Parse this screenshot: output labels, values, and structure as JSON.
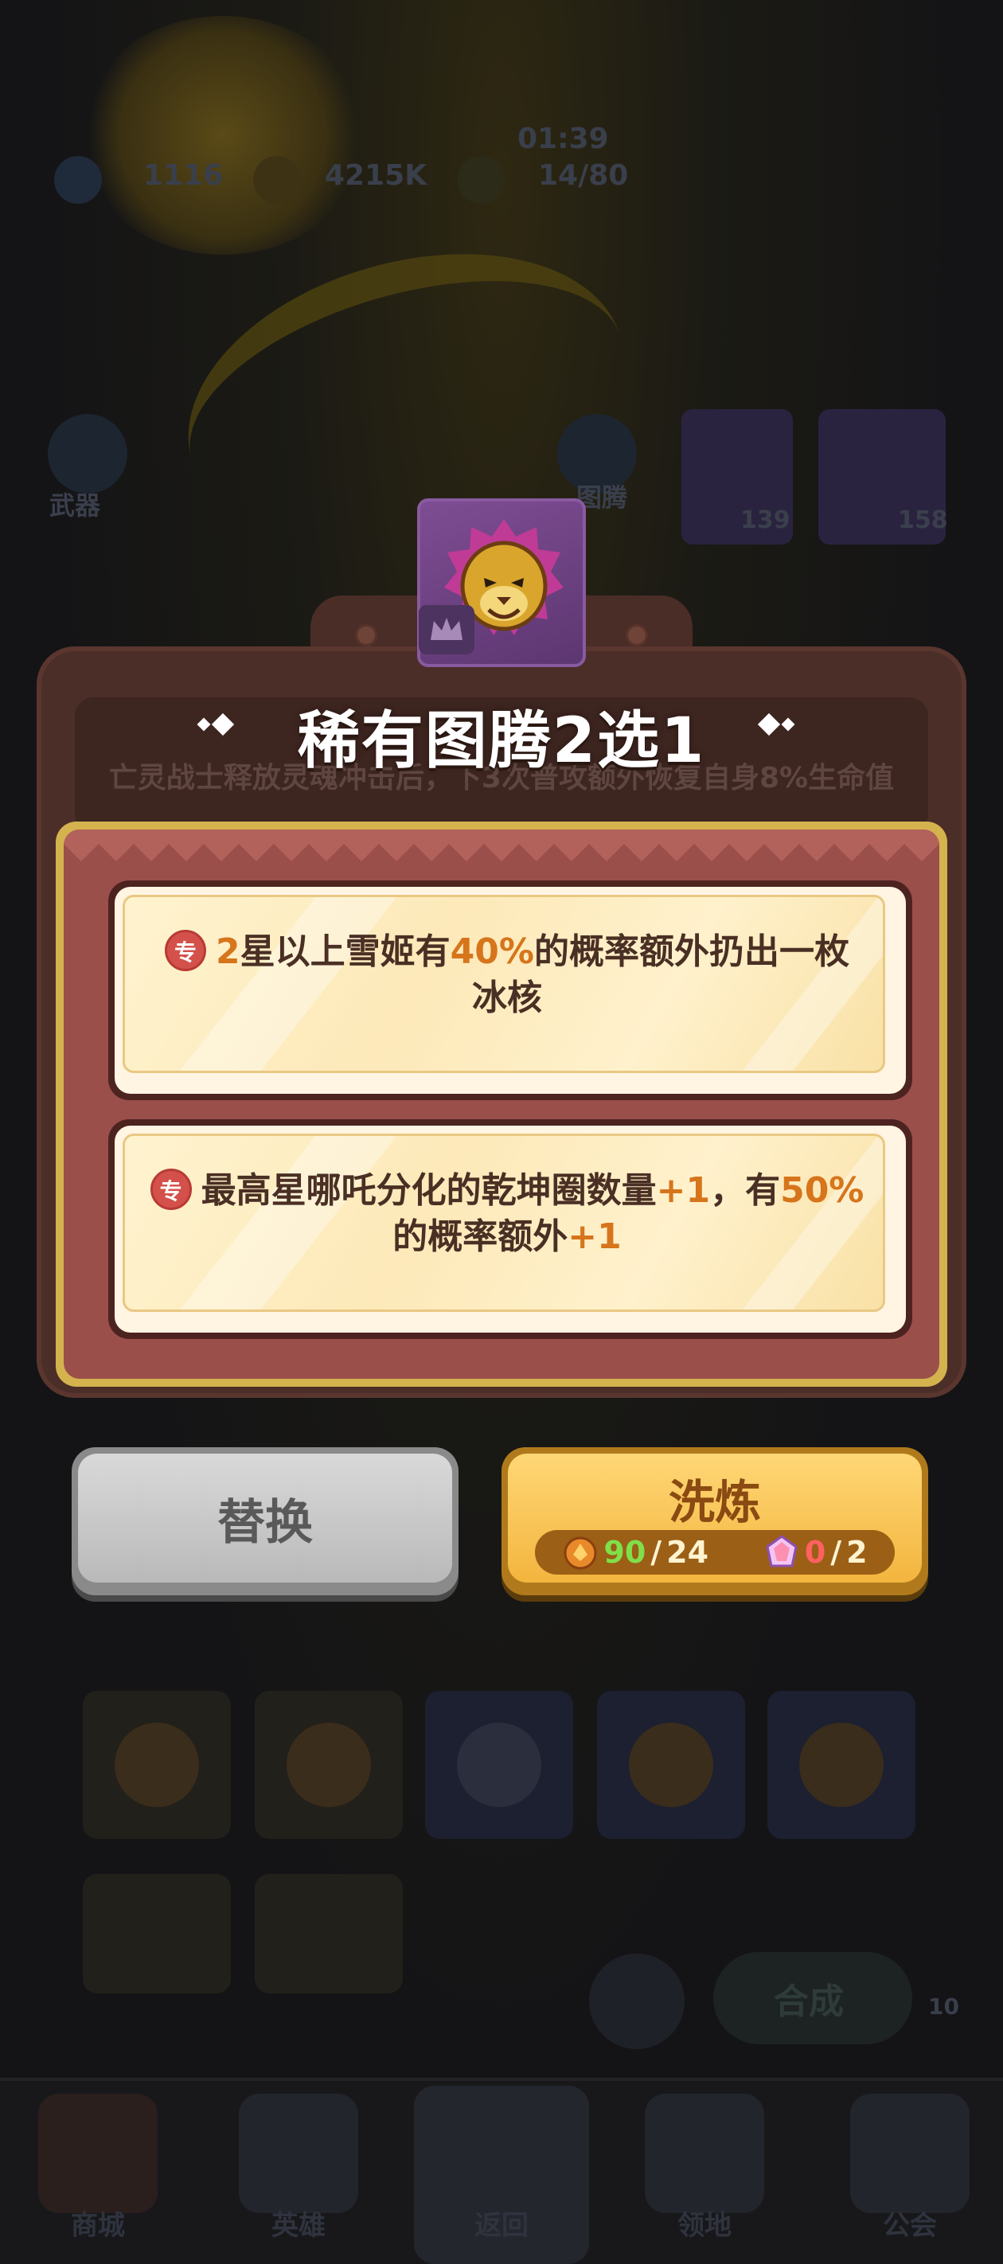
{
  "background": {
    "hud": {
      "timer": "01:39",
      "gems": "1116",
      "gold": "4215K",
      "wave": "14/80"
    },
    "left_labels": [
      "武器"
    ],
    "right_labels": [
      "图腾"
    ],
    "card_counts": [
      "139",
      "158"
    ],
    "synthesize_label": "合成",
    "synthesize_badge": "10",
    "bottom_nav": [
      "商城",
      "英雄",
      "返回",
      "领地",
      "公会"
    ]
  },
  "popup": {
    "ghost_description": "亡灵战士释放灵魂冲击后，下3次普攻额外恢复自身8%生命值",
    "title": "稀有图腾2选1",
    "options": [
      {
        "tag": "专",
        "parts": [
          {
            "t": "2",
            "hl": true
          },
          {
            "t": "星以上雪姬有",
            "hl": false
          },
          {
            "t": "40%",
            "hl": true
          },
          {
            "t": "的概率额外扔出一枚冰核",
            "hl": false
          }
        ]
      },
      {
        "tag": "专",
        "parts": [
          {
            "t": "最高星哪吒分化的乾坤圈数量",
            "hl": false
          },
          {
            "t": "+1",
            "hl": true
          },
          {
            "t": "，有",
            "hl": false
          },
          {
            "t": "50%",
            "hl": true
          },
          {
            "t": "的概率额外",
            "hl": false
          },
          {
            "t": "+1",
            "hl": true
          }
        ]
      }
    ],
    "replace_button": "替换",
    "refine_button": "洗炼",
    "costs": [
      {
        "icon": "ore-icon",
        "have": "90",
        "need": "24"
      },
      {
        "icon": "crystal-icon",
        "have": "0",
        "need": "2"
      }
    ]
  }
}
